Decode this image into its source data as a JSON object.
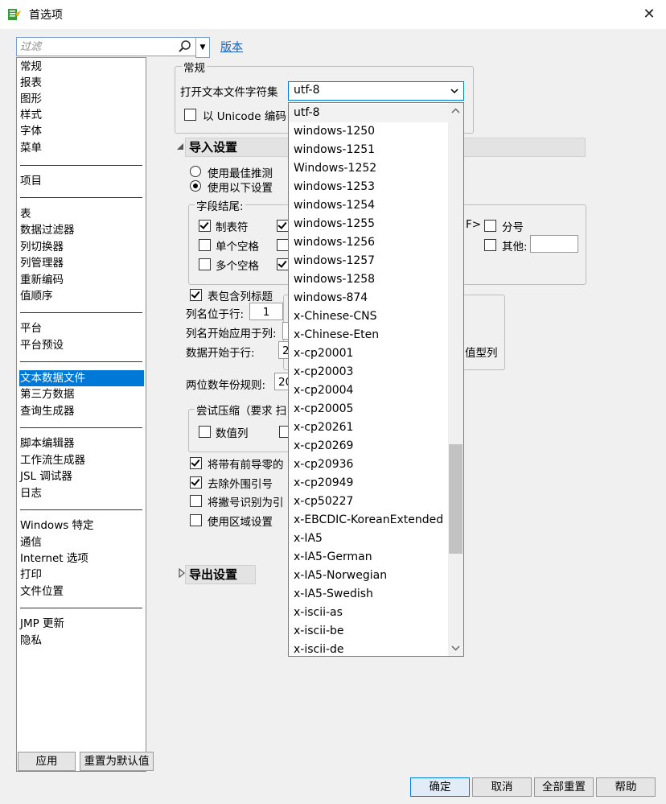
{
  "window": {
    "title": "首选项",
    "close_glyph": "✕"
  },
  "filter": {
    "placeholder": "过滤",
    "dropdown_glyph": "▼",
    "link": "版本"
  },
  "nav": {
    "groups": [
      [
        "常规",
        "报表",
        "图形",
        "样式",
        "字体",
        "菜单"
      ],
      [
        "项目"
      ],
      [
        "表",
        "数据过滤器",
        "列切换器",
        "列管理器",
        "重新编码",
        "值顺序"
      ],
      [
        "平台",
        "平台预设"
      ],
      [
        "文本数据文件",
        "第三方数据",
        "查询生成器"
      ],
      [
        "脚本编辑器",
        "工作流生成器",
        "JSL 调试器",
        "日志"
      ],
      [
        "Windows 特定",
        "通信",
        "Internet 选项",
        "打印",
        "文件位置"
      ],
      [
        "JMP 更新",
        "隐私"
      ]
    ],
    "selected": "文本数据文件"
  },
  "left_buttons": {
    "apply": "应用",
    "reset_default": "重置为默认值"
  },
  "bottom_buttons": {
    "ok": "确定",
    "cancel": "取消",
    "reset_all": "全部重置",
    "help": "帮助"
  },
  "general": {
    "legend": "常规",
    "charset_label": "打开文本文件字符集",
    "charset_value": "utf-8",
    "unicode_label": "以 Unicode 编码"
  },
  "import": {
    "header": "导入设置",
    "radio_best": "使用最佳推测",
    "radio_below": "使用以下设置",
    "field_end_legend": "字段结尾:",
    "tab": "制表符",
    "single_space": "单个空格",
    "multi_space": "多个空格",
    "other_frag": "F>",
    "semicolon": "分号",
    "other": "其他:",
    "has_header": "表包含列标题",
    "col_name_row_label": "列名位于行:",
    "col_name_row_value": "1",
    "col_name_start_label": "列名开始应用于列:",
    "data_start_label": "数据开始于行:",
    "data_start_value": "2",
    "numeric_col_frag": "值型列",
    "two_digit_label": "两位数年份规则:",
    "two_digit_value": "20",
    "compress_legend": "尝试压缩（要求 扫",
    "numeric_col": "数值列",
    "leading_zero": "将带有前导零的",
    "strip_quotes": "去除外围引号",
    "apostrophe": "将撇号识别为引",
    "locale": "使用区域设置"
  },
  "export": {
    "header": "导出设置"
  },
  "charset_options": [
    "utf-8",
    "windows-1250",
    "windows-1251",
    "Windows-1252",
    "windows-1253",
    "windows-1254",
    "windows-1255",
    "windows-1256",
    "windows-1257",
    "windows-1258",
    "windows-874",
    "x-Chinese-CNS",
    "x-Chinese-Eten",
    "x-cp20001",
    "x-cp20003",
    "x-cp20004",
    "x-cp20005",
    "x-cp20261",
    "x-cp20269",
    "x-cp20936",
    "x-cp20949",
    "x-cp50227",
    "x-EBCDIC-KoreanExtended",
    "x-IA5",
    "x-IA5-German",
    "x-IA5-Norwegian",
    "x-IA5-Swedish",
    "x-iscii-as",
    "x-iscii-be",
    "x-iscii-de"
  ],
  "icons": {
    "app": "jmp-app-icon",
    "search": "search-icon",
    "combo_arrow": "chevron-down-icon"
  },
  "colors": {
    "selection": "#0078d7",
    "link": "#1a5fb4"
  }
}
